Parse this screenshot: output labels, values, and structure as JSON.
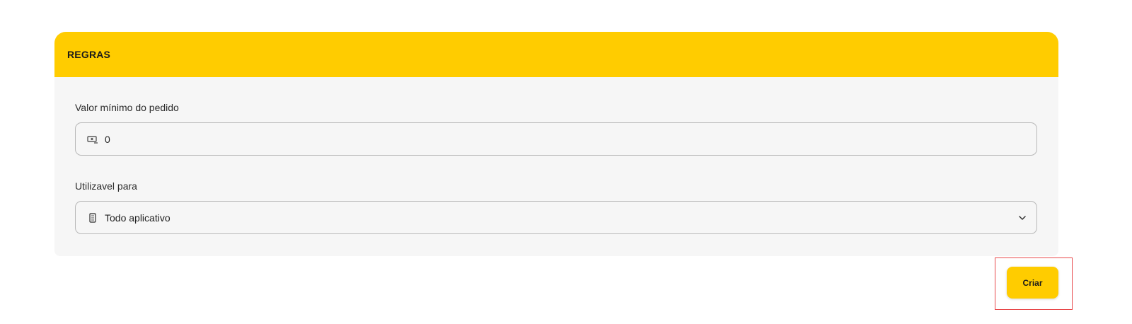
{
  "rules_card": {
    "title": "REGRAS",
    "header_color": "#ffcc00",
    "min_order": {
      "label": "Valor mínimo do pedido",
      "value": "0",
      "icon": "money-icon"
    },
    "usable_for": {
      "label": "Utilizavel para",
      "selected": "Todo aplicativo",
      "icon": "mobile-phone-icon"
    }
  },
  "actions": {
    "create_label": "Criar",
    "button_color": "#ffcc00",
    "highlight_color": "#e8484a"
  }
}
